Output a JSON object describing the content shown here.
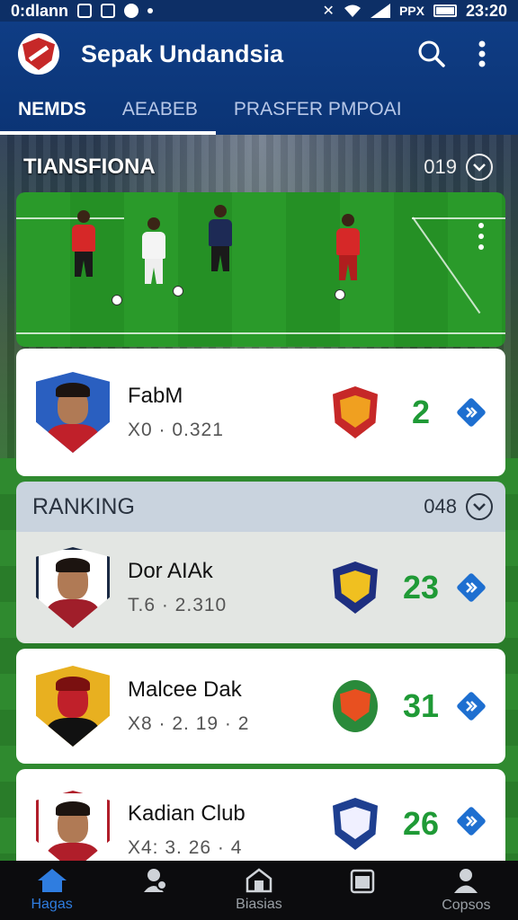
{
  "statusbar": {
    "left_text": "0:dlann",
    "right_text": "PPX",
    "time": "23:20"
  },
  "appbar": {
    "title": "Sepak Undandsia"
  },
  "tabs": [
    {
      "label": "NEMDS",
      "active": true
    },
    {
      "label": "AEABEB",
      "active": false
    },
    {
      "label": "PRASFER PMPOAI",
      "active": false
    }
  ],
  "highlights": {
    "title": "TIANSFIONA",
    "count": "019"
  },
  "ranking": {
    "title": "RANKING",
    "count": "048"
  },
  "players": [
    {
      "name": "FabM",
      "stat": "X0 · 0.321",
      "score": "2",
      "avatar_color": "#2a5fc0",
      "shirt_color": "#c0202a",
      "badge_outer": "#c62828",
      "badge_inner": "#f0a020"
    },
    {
      "name": "Dor AIAk",
      "stat": "T.6 · 2.310",
      "score": "23",
      "avatar_color": "#ffffff",
      "shirt_color": "#a01e2a",
      "badge_outer": "#1e2f80",
      "badge_inner": "#f0c020"
    },
    {
      "name": "Malcee Dak",
      "stat": "X8 · 2. 19 · 2",
      "score": "31",
      "avatar_color": "#e8b020",
      "shirt_color": "#111111",
      "badge_outer": "#2a8a3a",
      "badge_inner": "#e85020"
    },
    {
      "name": "Kadian Club",
      "stat": "X4: 3. 26 · 4",
      "score": "26",
      "avatar_color": "#ffffff",
      "shirt_color": "#b01e2a",
      "badge_outer": "#1e3f90",
      "badge_inner": "#f0f0ff"
    }
  ],
  "bottomnav": [
    {
      "label": "Hagas",
      "icon": "home-icon",
      "active": true
    },
    {
      "label": "",
      "icon": "players-icon",
      "active": false
    },
    {
      "label": "Biasias",
      "icon": "stadium-icon",
      "active": false
    },
    {
      "label": "",
      "icon": "calendar-icon",
      "active": false
    },
    {
      "label": "Copsos",
      "icon": "profile-icon",
      "active": false
    }
  ]
}
